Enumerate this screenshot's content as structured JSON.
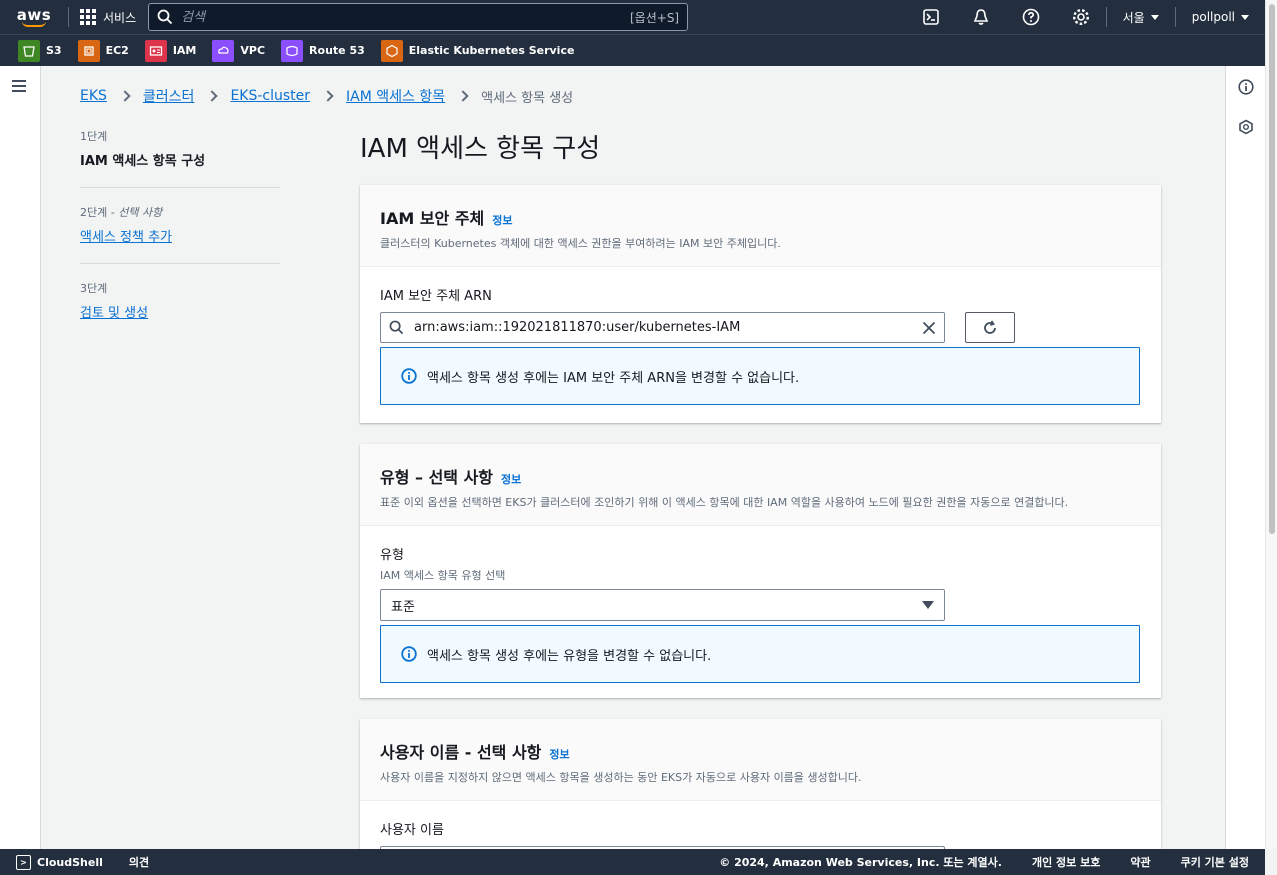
{
  "topnav": {
    "logo": "aws",
    "services_label": "서비스",
    "search_placeholder": "검색",
    "search_shortcut": "[옵션+S]",
    "region": "서울",
    "account": "pollpoll"
  },
  "favorites": [
    {
      "label": "S3",
      "color": "#3f8624",
      "icon": "s3-icon"
    },
    {
      "label": "EC2",
      "color": "#d86613",
      "icon": "ec2-icon"
    },
    {
      "label": "IAM",
      "color": "#dd344c",
      "icon": "iam-icon"
    },
    {
      "label": "VPC",
      "color": "#8c4fff",
      "icon": "vpc-icon"
    },
    {
      "label": "Route 53",
      "color": "#8c4fff",
      "icon": "route53-icon"
    },
    {
      "label": "Elastic Kubernetes Service",
      "color": "#d86613",
      "icon": "eks-icon"
    }
  ],
  "breadcrumb": {
    "items": [
      "EKS",
      "클러스터",
      "EKS-cluster",
      "IAM 액세스 항목"
    ],
    "current": "액세스 항목 생성"
  },
  "steps": [
    {
      "num": "1단계",
      "title": "IAM 액세스 항목 구성"
    },
    {
      "num": "2단계",
      "optional": " - 선택 사항",
      "title": "액세스 정책 추가"
    },
    {
      "num": "3단계",
      "title": "검토 및 생성"
    }
  ],
  "page_title": "IAM 액세스 항목 구성",
  "panel_principal": {
    "title": "IAM 보안 주체",
    "info": "정보",
    "description": "클러스터의 Kubernetes 객체에 대한 액세스 권한을 부여하려는 IAM 보안 주체입니다.",
    "field_label": "IAM 보안 주체 ARN",
    "arn_value": "arn:aws:iam::192021811870:user/kubernetes-IAM",
    "alert": "액세스 항목 생성 후에는 IAM 보안 주체 ARN을 변경할 수 없습니다."
  },
  "panel_type": {
    "title": "유형 – 선택 사항",
    "info": "정보",
    "description": "표준 이외 옵션을 선택하면 EKS가 클러스터에 조인하기 위해 이 액세스 항목에 대한 IAM 역할을 사용하여 노드에 필요한 권한을 자동으로 연결합니다.",
    "field_label": "유형",
    "field_sublabel": "IAM 액세스 항목 유형 선택",
    "selected": "표준",
    "alert": "액세스 항목 생성 후에는 유형을 변경할 수 없습니다."
  },
  "panel_username": {
    "title": "사용자 이름 - 선택 사항",
    "info": "정보",
    "description": "사용자 이름을 지정하지 않으면 액세스 항목을 생성하는 동안 EKS가 자동으로 사용자 이름을 생성합니다.",
    "field_label": "사용자 이름"
  },
  "footer": {
    "cloudshell": "CloudShell",
    "feedback": "의견",
    "copyright": "© 2024, Amazon Web Services, Inc. 또는 계열사.",
    "privacy": "개인 정보 보호",
    "terms": "약관",
    "cookies": "쿠키 기본 설정"
  }
}
